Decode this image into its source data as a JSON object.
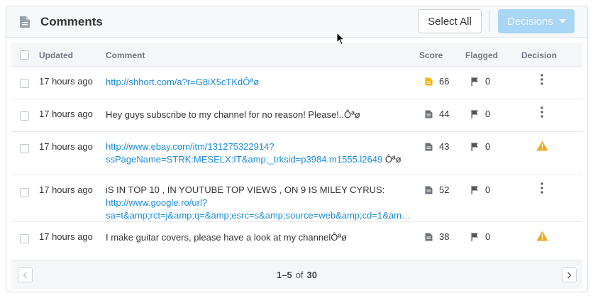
{
  "header": {
    "title": "Comments",
    "select_all_label": "Select All",
    "decisions_label": "Decisions"
  },
  "columns": {
    "updated": "Updated",
    "comment": "Comment",
    "score": "Score",
    "flagged": "Flagged",
    "decision": "Decision"
  },
  "rows": [
    {
      "updated": "17 hours ago",
      "comment_link": "http://shhort.com/a?r=G8iX5cTKdÔªø",
      "score": "66",
      "score_icon": "doc-orange-icon",
      "flagged": "0",
      "decision": "more-icon"
    },
    {
      "updated": "17 hours ago",
      "comment_text": "Hey guys subscribe to my channel for no reason! Please!..Ôªø",
      "score": "44",
      "score_icon": "doc-gray-icon",
      "flagged": "0",
      "decision": "more-icon"
    },
    {
      "updated": "17 hours ago",
      "comment_link_line1": "http://www.ebay.com/itm/131275322914?",
      "comment_link_line2": "ssPageName=STRK:MESELX:IT&amp;_trksid=p3984.m1555.l2649",
      "comment_suffix": " Ôªø",
      "score": "43",
      "score_icon": "doc-gray-icon",
      "flagged": "0",
      "decision": "warning-icon"
    },
    {
      "updated": "17 hours ago",
      "comment_text": "iS IN TOP 10 , IN YOUTUBE TOP VIEWS , ON 9 IS MILEY CYRUS:",
      "comment_link_line1": "http://www.google.ro/url?",
      "comment_link_line2": "sa=t&amp;rct=j&amp;q=&amp;esrc=s&amp;source=web&amp;cd=1&amp;...",
      "score": "52",
      "score_icon": "doc-gray-icon",
      "flagged": "0",
      "decision": "more-icon"
    },
    {
      "updated": "17 hours ago",
      "comment_text": "I make guitar covers, please have a look at my channelÔªø",
      "score": "38",
      "score_icon": "doc-gray-icon",
      "flagged": "0",
      "decision": "warning-icon"
    }
  ],
  "pagination": {
    "range": "1–5",
    "of_label": "of",
    "total": "30"
  },
  "colors": {
    "accent": "#a9d6f4",
    "link": "#1a8cd8",
    "warning": "#f4a51c",
    "score_highlight": "#f4b400"
  }
}
